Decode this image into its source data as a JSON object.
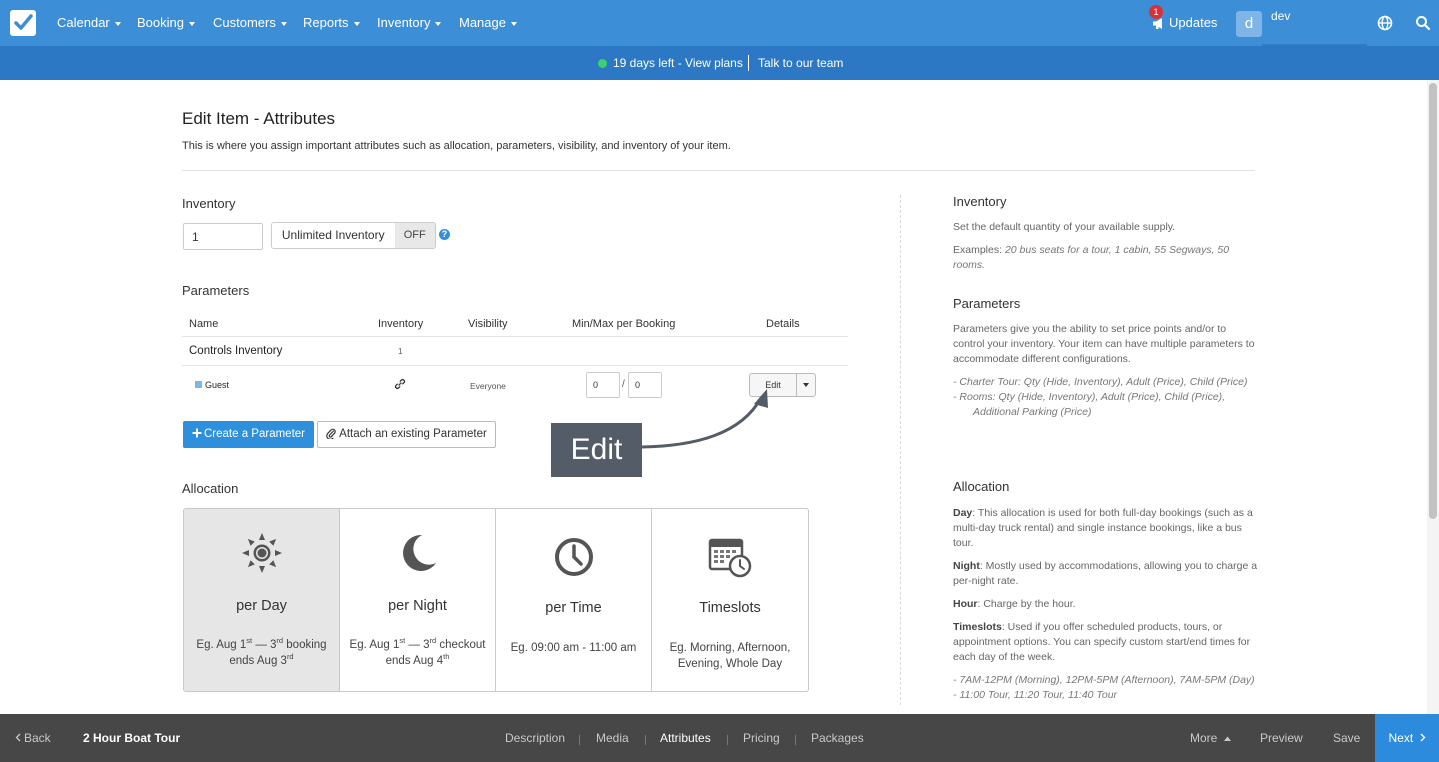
{
  "nav": {
    "items": [
      {
        "label": "Calendar"
      },
      {
        "label": "Booking"
      },
      {
        "label": "Customers"
      },
      {
        "label": "Reports"
      },
      {
        "label": "Inventory"
      },
      {
        "label": "Manage"
      }
    ],
    "updates_label": "Updates",
    "updates_count": "1",
    "avatar_letter": "d",
    "user_name": "dev"
  },
  "trial": {
    "text": "19 days left - View plans",
    "talk": "Talk to our team"
  },
  "page": {
    "title": "Edit Item - Attributes",
    "subtitle": "This is where you assign important attributes such as allocation, parameters, visibility, and inventory of your item."
  },
  "inventory": {
    "heading": "Inventory",
    "value": "1",
    "toggle_label": "Unlimited Inventory",
    "toggle_state": "OFF",
    "help": "?"
  },
  "parameters": {
    "heading": "Parameters",
    "columns": [
      "Name",
      "Inventory",
      "Visibility",
      "Min/Max per Booking",
      "Details"
    ],
    "group_label": "Controls Inventory",
    "group_inventory": "1",
    "row": {
      "name": "Guest",
      "visibility": "Everyone",
      "min": "0",
      "max": "0",
      "slash": "/",
      "edit_label": "Edit"
    },
    "create_label": "Create a Parameter",
    "attach_label": "Attach an existing Parameter"
  },
  "tooltip": {
    "text": "Edit"
  },
  "allocation": {
    "heading": "Allocation",
    "cards": [
      {
        "title": "per Day",
        "desc_a": "Eg. Aug 1",
        "sup_a": "st",
        "desc_b": " — 3",
        "sup_b": "rd",
        "desc_c": " booking ends Aug 3",
        "sup_c": "rd",
        "selected": true
      },
      {
        "title": "per Night",
        "desc_a": "Eg. Aug 1",
        "sup_a": "st",
        "desc_b": " — 3",
        "sup_b": "rd",
        "desc_c": " checkout ends Aug 4",
        "sup_c": "th",
        "selected": false
      },
      {
        "title": "per Time",
        "desc": "Eg. 09:00 am - 11:00 am",
        "selected": false
      },
      {
        "title": "Timeslots",
        "desc": "Eg. Morning, Afternoon, Evening, Whole Day",
        "selected": false
      }
    ]
  },
  "help_panel": {
    "inventory_h": "Inventory",
    "inventory_p1": "Set the default quantity of your available supply.",
    "inventory_p2_lead": "Examples: ",
    "inventory_p2_em": "20 bus seats for a tour, 1 cabin, 55 Segways, 50 rooms.",
    "parameters_h": "Parameters",
    "parameters_p1": "Parameters give you the ability to set price points and/or to control your inventory. Your item can have multiple parameters to accommodate different configurations.",
    "parameters_ex1": "- Charter Tour: Qty (Hide, Inventory), Adult (Price), Child (Price)",
    "parameters_ex2": "- Rooms: Qty (Hide, Inventory), Adult (Price), Child (Price),",
    "parameters_ex3": "Additional Parking (Price)",
    "allocation_h": "Allocation",
    "day_b": "Day",
    "day_p": ": This allocation is used for both full-day bookings (such as a multi-day truck rental) and single instance bookings, like a bus tour.",
    "night_b": "Night",
    "night_p": ": Mostly used by accommodations, allowing you to charge a per-night rate.",
    "hour_b": "Hour",
    "hour_p": ": Charge by the hour.",
    "timeslots_b": "Timeslots",
    "timeslots_p": ": Used if you offer scheduled products, tours, or appointment options. You can specify custom start/end times for each day of the week.",
    "ts_ex1": "- 7AM-12PM (Morning), 12PM-5PM (Afternoon), 7AM-5PM (Day)",
    "ts_ex2": "- 11:00 Tour, 11:20 Tour, 11:40 Tour"
  },
  "bottom": {
    "back": "Back",
    "item_title": "2 Hour Boat Tour",
    "tabs": [
      "Description",
      "Media",
      "Attributes",
      "Pricing",
      "Packages"
    ],
    "active_tab": "Attributes",
    "more": "More",
    "preview": "Preview",
    "save": "Save",
    "next": "Next"
  },
  "colors": {
    "nav_bg": "#3c8fd6",
    "trial_bg": "#2c78c4",
    "primary": "#2e8fdc",
    "bottom_bg": "#474747"
  }
}
